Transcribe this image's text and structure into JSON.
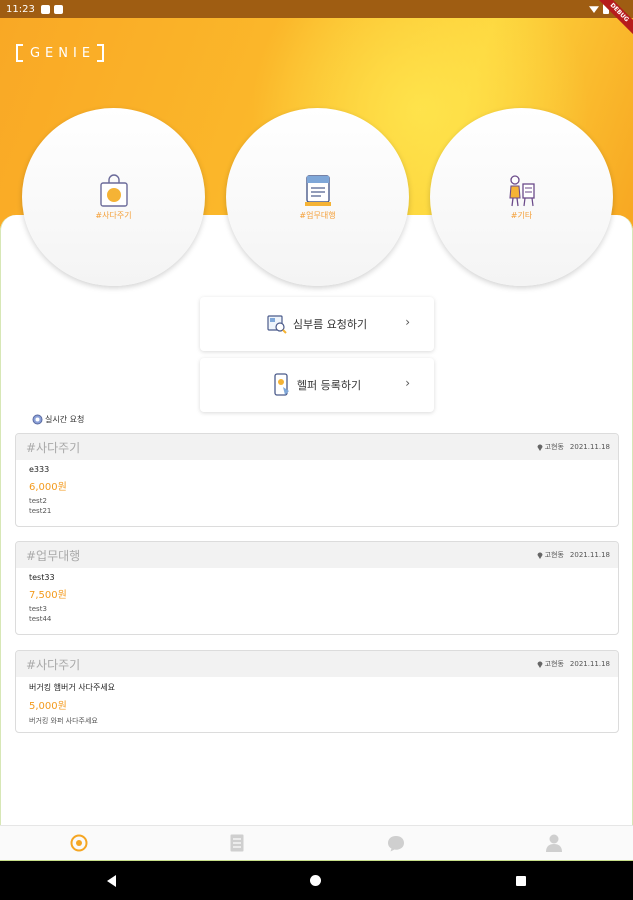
{
  "status_bar": {
    "time": "11:23",
    "debug_banner": "DEBUG"
  },
  "logo": {
    "text": "GENIE"
  },
  "categories": [
    {
      "label": "#사다주기",
      "icon": "shopping-bag-icon"
    },
    {
      "label": "#업무대행",
      "icon": "document-icon"
    },
    {
      "label": "#기타",
      "icon": "person-checklist-icon"
    }
  ],
  "actions": [
    {
      "label": "심부름 요청하기",
      "icon": "request-icon"
    },
    {
      "label": "헬퍼 등록하기",
      "icon": "helper-phone-icon"
    }
  ],
  "realtime_label": "실시간 요청",
  "requests": [
    {
      "category": "#사다주기",
      "location": "고현동",
      "date": "2021.11.18",
      "title": "e333",
      "price": "6,000원",
      "lines": [
        "test2",
        "test21"
      ]
    },
    {
      "category": "#업무대행",
      "location": "고현동",
      "date": "2021.11.18",
      "title": "test33",
      "price": "7,500원",
      "lines": [
        "test3",
        "test44"
      ]
    },
    {
      "category": "#사다주기",
      "location": "고현동",
      "date": "2021.11.18",
      "title": "버거킹 햄버거 사다주세요",
      "price": "5,000원",
      "lines": [
        "버거킹 와퍼 사다주세요"
      ]
    }
  ],
  "bottom_nav": [
    {
      "icon": "home-target-icon",
      "active": true
    },
    {
      "icon": "list-icon",
      "active": false
    },
    {
      "icon": "chat-bubble-icon",
      "active": false
    },
    {
      "icon": "profile-icon",
      "active": false
    }
  ],
  "colors": {
    "accent": "#f39a1d",
    "header_gradient_start": "#f9a825",
    "header_gradient_end": "#fdd43c",
    "muted": "#a9a9a9"
  }
}
